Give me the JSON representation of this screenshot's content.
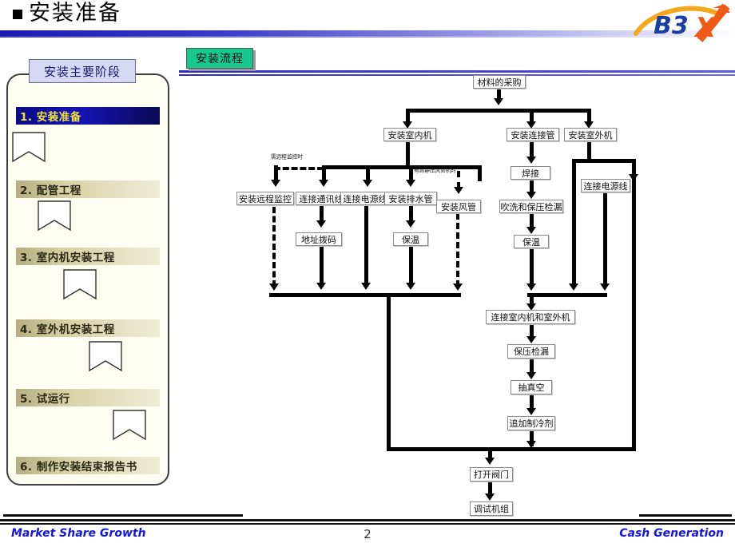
{
  "header": {
    "title": "安装准备",
    "bullet": "square-bullet"
  },
  "logo": {
    "text_b3": "B3",
    "text_x": "X",
    "alt": "b3x-logo"
  },
  "sidebar": {
    "caption": "安装主要阶段",
    "stages": [
      {
        "label": "1. 安装准备",
        "active": true
      },
      {
        "label": "2. 配管工程",
        "active": false
      },
      {
        "label": "3. 室内机安装工程",
        "active": false
      },
      {
        "label": "4. 室外机安装工程",
        "active": false
      },
      {
        "label": "5. 试运行",
        "active": false
      },
      {
        "label": "6. 制作安装结束报告书",
        "active": false
      }
    ]
  },
  "panel": {
    "tab_label": "安装流程"
  },
  "flow": {
    "nodes": [
      {
        "id": "n1",
        "label": "材料的采购"
      },
      {
        "id": "n2",
        "label": "安装室内机"
      },
      {
        "id": "n3",
        "label": "安装连接管"
      },
      {
        "id": "n4",
        "label": "安装室外机"
      },
      {
        "id": "n5",
        "label": "安装远程监控"
      },
      {
        "id": "n6",
        "label": "连接通讯线"
      },
      {
        "id": "n7",
        "label": "连接电源线"
      },
      {
        "id": "n8",
        "label": "安装排水管"
      },
      {
        "id": "n9",
        "label": "安装风管"
      },
      {
        "id": "n10",
        "label": "地址拨码"
      },
      {
        "id": "n11",
        "label": "保温"
      },
      {
        "id": "n12",
        "label": "焊接"
      },
      {
        "id": "n13",
        "label": "吹洗和保压检漏"
      },
      {
        "id": "n14",
        "label": "保温"
      },
      {
        "id": "n15",
        "label": "连接电源线"
      },
      {
        "id": "n16",
        "label": "连接室内机和室外机"
      },
      {
        "id": "n17",
        "label": "保压检漏"
      },
      {
        "id": "n18",
        "label": "抽真空"
      },
      {
        "id": "n19",
        "label": "追加制冷剂"
      },
      {
        "id": "n20",
        "label": "打开阀门"
      },
      {
        "id": "n21",
        "label": "调试机组"
      }
    ],
    "notes": [
      {
        "id": "note1",
        "label": "需远程监控时"
      },
      {
        "id": "note2",
        "label": "有高静压风管机时"
      }
    ]
  },
  "footer": {
    "left": "Market Share Growth",
    "page": "2",
    "right": "Cash Generation"
  }
}
